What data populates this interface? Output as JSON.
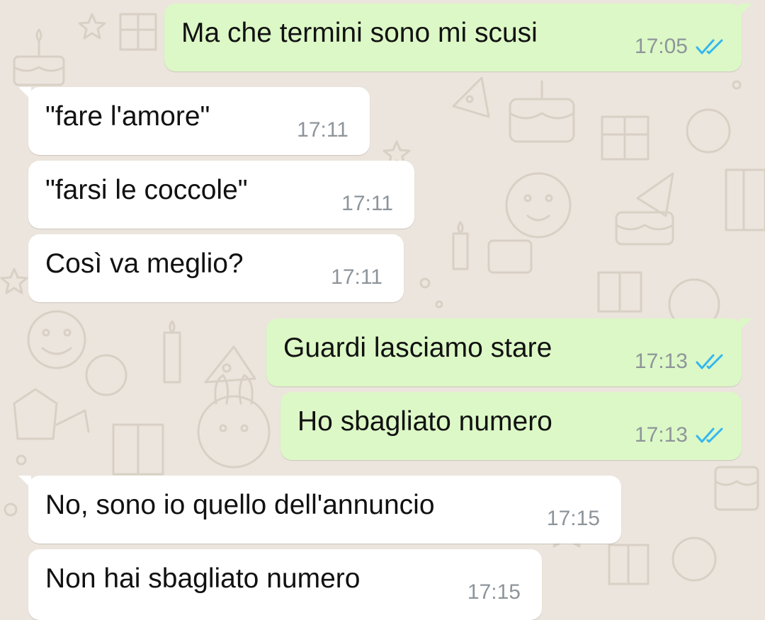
{
  "colors": {
    "wallpaper": "#ece5dd",
    "incoming_bubble": "#ffffff",
    "outgoing_bubble": "#dcf8c6",
    "read_ticks": "#34b7f1",
    "timestamp": "#8e959a",
    "message_text": "#111111"
  },
  "messages": [
    {
      "direction": "outgoing",
      "text": "Ma che termini sono mi scusi",
      "time": "17:05",
      "status": "read",
      "status_icon": "double-check-icon"
    },
    {
      "direction": "incoming",
      "text": "\"fare l'amore\"",
      "time": "17:11"
    },
    {
      "direction": "incoming",
      "text": "\"farsi le coccole\"",
      "time": "17:11"
    },
    {
      "direction": "incoming",
      "text": "Così va meglio?",
      "time": "17:11"
    },
    {
      "direction": "outgoing",
      "text": "Guardi lasciamo stare",
      "time": "17:13",
      "status": "read",
      "status_icon": "double-check-icon"
    },
    {
      "direction": "outgoing",
      "text": "Ho sbagliato numero",
      "time": "17:13",
      "status": "read",
      "status_icon": "double-check-icon"
    },
    {
      "direction": "incoming",
      "text": "No, sono io quello dell'annuncio",
      "time": "17:15"
    },
    {
      "direction": "incoming",
      "text": "Non hai sbagliato numero",
      "time": "17:15"
    }
  ]
}
